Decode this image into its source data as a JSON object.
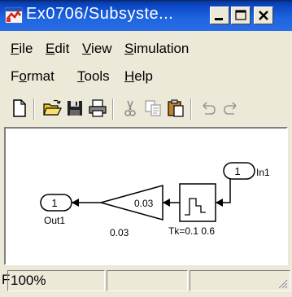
{
  "window": {
    "title": "Ex0706/Subsyste..."
  },
  "menubar": {
    "row1": [
      {
        "label": "File",
        "ul": "F",
        "rest": "ile"
      },
      {
        "label": "Edit",
        "ul": "E",
        "rest": "dit"
      },
      {
        "label": "View",
        "ul": "V",
        "rest": "iew"
      },
      {
        "label": "Simulation",
        "ul": "S",
        "rest": "imulation"
      }
    ],
    "row2": [
      {
        "label": "Format",
        "pre": "F",
        "ul": "o",
        "rest": "rmat"
      },
      {
        "label": "Tools",
        "pre": "",
        "ul": "T",
        "rest": "ools"
      },
      {
        "label": "Help",
        "pre": "",
        "ul": "H",
        "rest": "elp"
      }
    ]
  },
  "toolbar": {
    "icons": [
      "new-icon",
      "open-icon",
      "save-icon",
      "print-icon",
      "cut-icon",
      "copy-icon",
      "paste-icon",
      "undo-icon",
      "redo-icon"
    ]
  },
  "diagram": {
    "in_port": {
      "number": "1",
      "label": "In1"
    },
    "out_port": {
      "number": "1",
      "label": "Out1"
    },
    "gain": {
      "value": "0.03",
      "label": "0.03"
    },
    "zoh": {
      "label": "Tk=0.1 0.6"
    }
  },
  "statusbar": {
    "prefix": "F",
    "zoom": "100%"
  },
  "colors": {
    "titlebar": "#0b49c8",
    "window_bg": "#ece9d8",
    "canvas_bg": "#ffffff"
  }
}
